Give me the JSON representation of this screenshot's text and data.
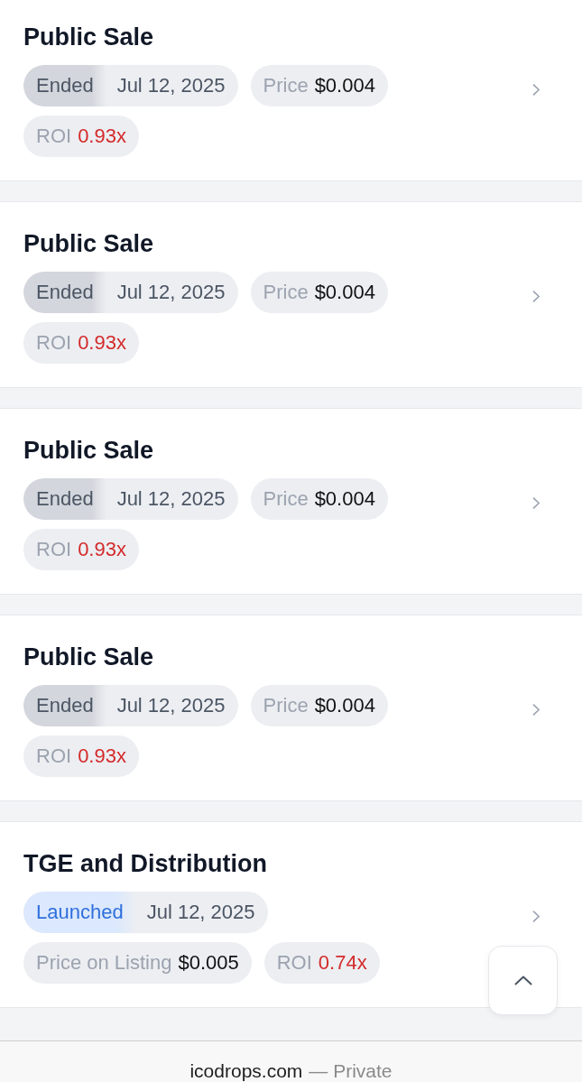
{
  "sales": [
    {
      "title": "Public Sale",
      "status": {
        "label": "Ended",
        "kind": "ended"
      },
      "date": "Jul 12, 2025",
      "metrics": [
        {
          "label": "Price",
          "value": "$0.004",
          "negative": false
        },
        {
          "label": "ROI",
          "value": "0.93x",
          "negative": true
        }
      ]
    },
    {
      "title": "Public Sale",
      "status": {
        "label": "Ended",
        "kind": "ended"
      },
      "date": "Jul 12, 2025",
      "metrics": [
        {
          "label": "Price",
          "value": "$0.004",
          "negative": false
        },
        {
          "label": "ROI",
          "value": "0.93x",
          "negative": true
        }
      ]
    },
    {
      "title": "Public Sale",
      "status": {
        "label": "Ended",
        "kind": "ended"
      },
      "date": "Jul 12, 2025",
      "metrics": [
        {
          "label": "Price",
          "value": "$0.004",
          "negative": false
        },
        {
          "label": "ROI",
          "value": "0.93x",
          "negative": true
        }
      ]
    },
    {
      "title": "Public Sale",
      "status": {
        "label": "Ended",
        "kind": "ended"
      },
      "date": "Jul 12, 2025",
      "metrics": [
        {
          "label": "Price",
          "value": "$0.004",
          "negative": false
        },
        {
          "label": "ROI",
          "value": "0.93x",
          "negative": true
        }
      ]
    },
    {
      "title": "TGE and Distribution",
      "status": {
        "label": "Launched",
        "kind": "launched"
      },
      "date": "Jul 12, 2025",
      "metrics": [
        {
          "label": "Price on Listing",
          "value": "$0.005",
          "negative": false
        },
        {
          "label": "ROI",
          "value": "0.74x",
          "negative": true
        }
      ]
    }
  ],
  "address_bar": {
    "domain": "icodrops.com",
    "mode": "— Private"
  }
}
